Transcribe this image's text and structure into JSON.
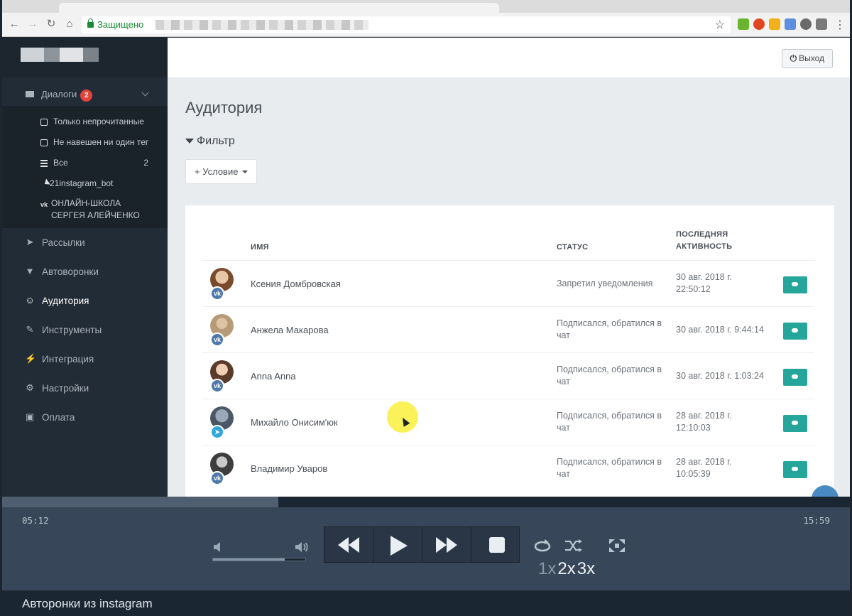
{
  "browser": {
    "security_label": "Защищено"
  },
  "sidebar": {
    "dialogs": {
      "label": "Диалоги",
      "badge": "2"
    },
    "dialog_filters": [
      {
        "label": "Только непрочитанные",
        "count": ""
      },
      {
        "label": "Не навешен ни один тег",
        "count": ""
      },
      {
        "label": "Все",
        "count": "2"
      },
      {
        "label": "21instagram_bot",
        "count": ""
      },
      {
        "label": "ОНЛАЙН-ШКОЛА СЕРГЕЯ АЛЕЙЧЕНКО",
        "count": ""
      }
    ],
    "items": [
      {
        "label": "Рассылки"
      },
      {
        "label": "Автоворонки"
      },
      {
        "label": "Аудитория"
      },
      {
        "label": "Инструменты"
      },
      {
        "label": "Интеграция"
      },
      {
        "label": "Настройки"
      },
      {
        "label": "Оплата"
      }
    ]
  },
  "header": {
    "logout_label": "Выход"
  },
  "page": {
    "title": "Аудитория",
    "filter_title": "Фильтр",
    "condition_button": "+ Условие"
  },
  "table": {
    "headers": {
      "name": "ИМЯ",
      "status": "СТАТУС",
      "activity": "ПОСЛЕДНЯЯ АКТИВНОСТЬ"
    },
    "rows": [
      {
        "name": "Ксения Домбровская",
        "status": "Запретил уведомления",
        "activity": "30 авг. 2018 г. 22:50:12",
        "network": "vk"
      },
      {
        "name": "Анжела Макарова",
        "status": "Подписался, обратился в чат",
        "activity": "30 авг. 2018 г. 9:44:14",
        "network": "vk"
      },
      {
        "name": "Anna Anna",
        "status": "Подписался, обратился в чат",
        "activity": "30 авг. 2018 г. 1:03:24",
        "network": "vk"
      },
      {
        "name": "Михайло Онисим'юк",
        "status": "Подписался, обратился в чат",
        "activity": "28 авг. 2018 г. 12:10:03",
        "network": "telegram"
      },
      {
        "name": "Владимир Уваров",
        "status": "Подписался, обратился в чат",
        "activity": "28 авг. 2018 г. 10:05:39",
        "network": "vk"
      }
    ]
  },
  "player": {
    "current_time": "05:12",
    "total_time": "15:59",
    "progress_fraction": 0.326,
    "volume_fraction": 0.78,
    "speeds": [
      "1x",
      "2x",
      "3x"
    ],
    "active_speeds": [
      "2x",
      "3x"
    ],
    "caption": "Авторонки из instagram"
  },
  "colors": {
    "sidebar_bg": "#222c36",
    "accent_teal": "#26a69a",
    "badge_red": "#e5443b",
    "vk_blue": "#4f79a8",
    "telegram_blue": "#33a6dc"
  }
}
